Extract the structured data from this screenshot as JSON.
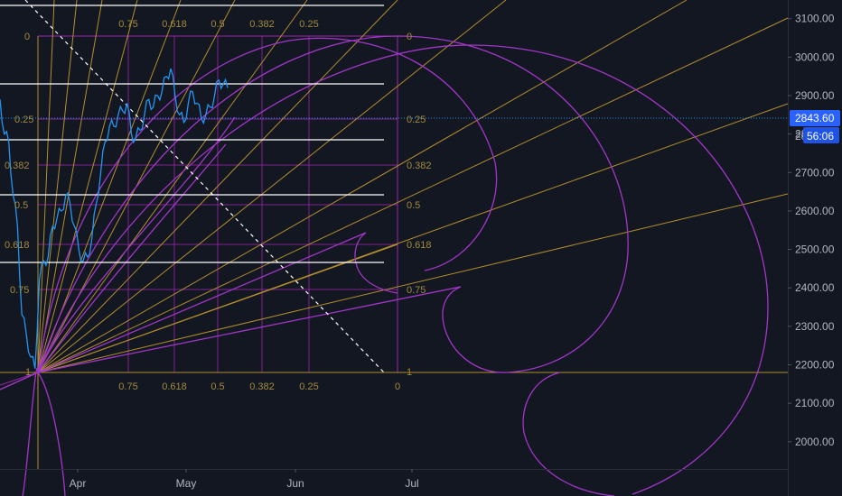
{
  "chart_data": {
    "type": "line",
    "title": "",
    "xlabel": "",
    "ylabel": "",
    "ylim": [
      1915,
      3170
    ],
    "grid": false,
    "x_ticks": [
      "Apr",
      "May",
      "Jun",
      "Jul"
    ],
    "y_ticks": [
      "3100.00",
      "3000.00",
      "2900.00",
      "2800.00",
      "2700.00",
      "2600.00",
      "2500.00",
      "2400.00",
      "2300.00",
      "2200.00",
      "2100.00",
      "2000.00"
    ],
    "y_tick_values": [
      3100,
      3000,
      2900,
      2800,
      2700,
      2600,
      2500,
      2400,
      2300,
      2200,
      2100,
      2000
    ],
    "price_series": {
      "days": [
        0,
        1,
        2,
        3,
        4,
        5,
        6,
        7,
        8,
        9,
        10,
        11,
        12,
        13,
        14,
        15,
        16,
        17,
        18,
        19,
        20,
        21,
        22,
        23,
        24,
        25,
        26,
        27,
        28,
        29,
        30,
        31,
        32,
        33,
        34,
        35,
        36,
        37,
        38,
        39,
        40,
        41,
        42,
        43,
        44,
        45,
        46,
        47,
        48,
        49,
        50,
        51,
        52
      ],
      "values": [
        2890,
        2800,
        2780,
        2640,
        2560,
        2330,
        2280,
        2220,
        2190,
        2420,
        2470,
        2480,
        2560,
        2580,
        2600,
        2640,
        2620,
        2560,
        2500,
        2470,
        2480,
        2530,
        2620,
        2700,
        2780,
        2820,
        2820,
        2850,
        2860,
        2880,
        2800,
        2790,
        2810,
        2850,
        2890,
        2870,
        2900,
        2910,
        2950,
        2970,
        2900,
        2850,
        2830,
        2880,
        2910,
        2880,
        2840,
        2850,
        2870,
        2900,
        2940,
        2930,
        2920
      ]
    },
    "current_price_label": "2843.60",
    "countdown_label": "56:06",
    "partial_price_label": "28",
    "fib_levels": [
      "0",
      "0.25",
      "0.382",
      "0.5",
      "0.618",
      "0.75",
      "1"
    ],
    "fib_vertical_labels": [
      "0.75",
      "0.618",
      "0.5",
      "0.382",
      "0.25",
      "0"
    ],
    "level_prices": [
      3140,
      2938,
      2790,
      2645,
      2470
    ],
    "colors": {
      "background": "#131722",
      "price_line": "#2196f3",
      "fib_gold": "#b28e2e",
      "fib_label": "#a08a3c",
      "grid_magenta": "#9c27b0",
      "circle_purple": "#a236c8",
      "horizontal_white": "#ffffff",
      "axis_text": "#b2b5be",
      "price_badge": "#2962ff"
    }
  }
}
